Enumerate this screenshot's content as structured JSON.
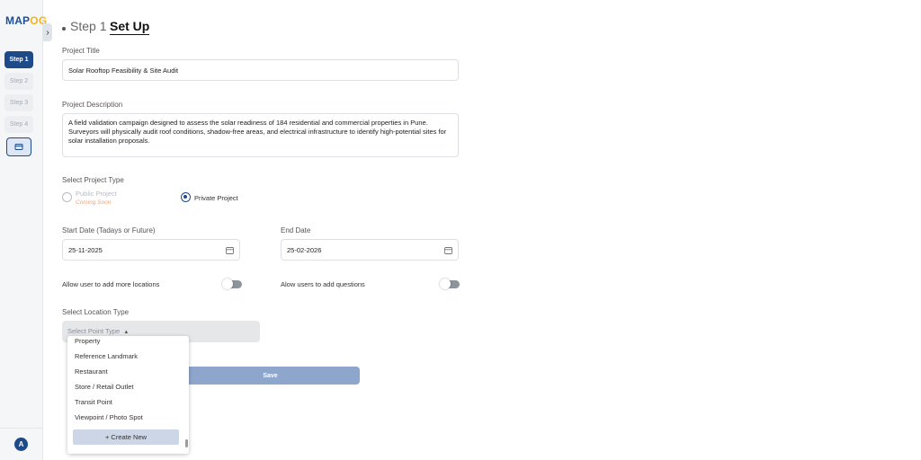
{
  "logo": {
    "text_main": "MAP",
    "text_accent": "OG"
  },
  "sidebar": {
    "steps": [
      {
        "label": "Step 1",
        "active": true
      },
      {
        "label": "Step 2",
        "active": false
      },
      {
        "label": "Step 3",
        "active": false
      },
      {
        "label": "Step 4",
        "active": false
      }
    ],
    "map_icon": "map-icon",
    "avatar_initial": "A"
  },
  "header": {
    "step": "Step 1",
    "title": "Set Up"
  },
  "form": {
    "title_label": "Project Title",
    "title_value": "Solar Rooftop Feasibility & Site Audit",
    "description_label": "Project Description",
    "description_value": "A field validation campaign designed to assess the solar readiness of 184 residential and commercial properties in Pune. Surveyors will physically audit roof conditions, shadow-free areas, and electrical infrastructure to identify high-potential sites for solar installation proposals.",
    "project_type_label": "Select Project Type",
    "public_label": "Public Project",
    "public_note": "Coming Soon",
    "private_label": "Private Project",
    "selected_type": "private",
    "start_label": "Start Date (Tadays or Future)",
    "start_value": "25-11-2025",
    "end_label": "End Date",
    "end_value": "25-02-2026",
    "allow_locations_label": "Allow user to add more locations",
    "allow_locations_on": false,
    "allow_questions_label": "Alow users to add questions",
    "allow_questions_on": false,
    "location_type_label": "Select Location Type",
    "location_placeholder": "Select Point Type",
    "save_label": "Save"
  },
  "dropdown": {
    "options": [
      "Property",
      "Reference Landmark",
      "Restaurant",
      "Store / Retail Outlet",
      "Transit Point",
      "Viewpoint / Photo Spot"
    ],
    "create_label": "+ Create New"
  },
  "colors": {
    "primary": "#1e4a8a",
    "accent": "#f2b51c",
    "coming_soon": "#f0a37a",
    "save_bg": "#8ea6cb"
  }
}
